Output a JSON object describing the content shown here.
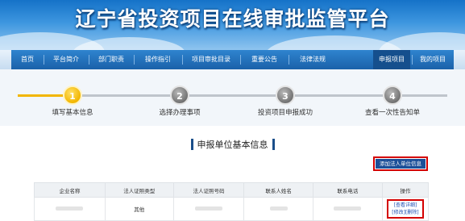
{
  "header": {
    "title": "辽宁省投资项目在线审批监管平台"
  },
  "nav": {
    "items": [
      "首页",
      "平台简介",
      "部门职责",
      "操作指引",
      "项目审批目录",
      "重要公告",
      "法律法规",
      "申报项目",
      "我的项目"
    ],
    "active": "申报项目"
  },
  "steps": [
    {
      "number": "1",
      "label": "填写基本信息",
      "state": "current"
    },
    {
      "number": "2",
      "label": "选择办理事项",
      "state": "pending"
    },
    {
      "number": "3",
      "label": "投资项目申报成功",
      "state": "pending"
    },
    {
      "number": "4",
      "label": "查看一次性告知单",
      "state": "pending"
    }
  ],
  "section": {
    "title": "申报单位基本信息"
  },
  "add_button": {
    "label": "添加法人单位信息"
  },
  "table": {
    "headers": [
      "企业名称",
      "法人证照类型",
      "法人证照号码",
      "联系人姓名",
      "联系电话",
      "操作"
    ],
    "row": {
      "cert_type": "其他"
    },
    "actions": {
      "view": "[查看详细]",
      "edit": "[修改]",
      "delete": "[删除]"
    }
  },
  "colors": {
    "brand_blue": "#1a61a9",
    "accent_yellow": "#f2b600",
    "highlight_red": "#d40000"
  }
}
